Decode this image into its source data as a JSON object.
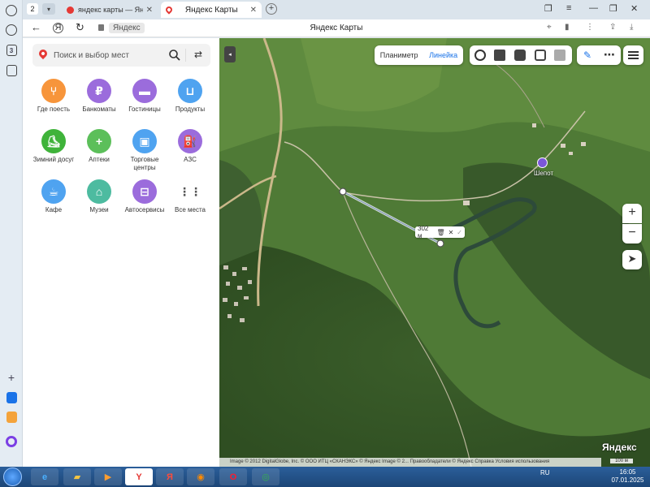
{
  "browser": {
    "tab_count": "2",
    "tabs": [
      {
        "label": "яндекс карты — Яндекс: н",
        "active": false
      },
      {
        "label": "Яндекс Карты",
        "active": true
      }
    ],
    "domain": "Яндекс",
    "page_title": "Яндекс Карты"
  },
  "search": {
    "placeholder": "Поиск и выбор мест"
  },
  "categories": [
    {
      "label": "Где поесть",
      "icon": "fork-knife-icon",
      "color": "#f7953b"
    },
    {
      "label": "Банкоматы",
      "icon": "ruble-icon",
      "color": "#9b6cdc"
    },
    {
      "label": "Гостиницы",
      "icon": "bed-icon",
      "color": "#9b6cdc"
    },
    {
      "label": "Продукты",
      "icon": "basket-icon",
      "color": "#4fa3f0"
    },
    {
      "label": "Зимний досуг",
      "icon": "skate-icon",
      "color": "#3fb33a"
    },
    {
      "label": "Аптеки",
      "icon": "plus-icon",
      "color": "#5cbf5a"
    },
    {
      "label": "Торговые центры",
      "icon": "bag-icon",
      "color": "#4fa3f0"
    },
    {
      "label": "АЗС",
      "icon": "fuel-icon",
      "color": "#9b6cdc"
    },
    {
      "label": "Кафе",
      "icon": "cup-icon",
      "color": "#4fa3f0"
    },
    {
      "label": "Музеи",
      "icon": "museum-icon",
      "color": "#4dbba0"
    },
    {
      "label": "Автосервисы",
      "icon": "car-icon",
      "color": "#9b6cdc"
    },
    {
      "label": "Все места",
      "icon": "grid-icon",
      "color": "#ffffff"
    }
  ],
  "map": {
    "mode_scheme": "Планиметр",
    "mode_ruler": "Линейка",
    "ruler_distance": "302 м",
    "poi_name": "Шепот",
    "logo": "Яндекс",
    "scale": "100 м",
    "copyright": "Image © 2012 DigitalGlobe, Inc. © ООО ИТЦ «СКАНЭКС» © Яндекс Image © 2...   Правообладатели   © Яндекс   Справка   Условия использования"
  },
  "taskbar": {
    "tray_lang": "RU",
    "time": "16:05",
    "date": "07.01.2025"
  }
}
